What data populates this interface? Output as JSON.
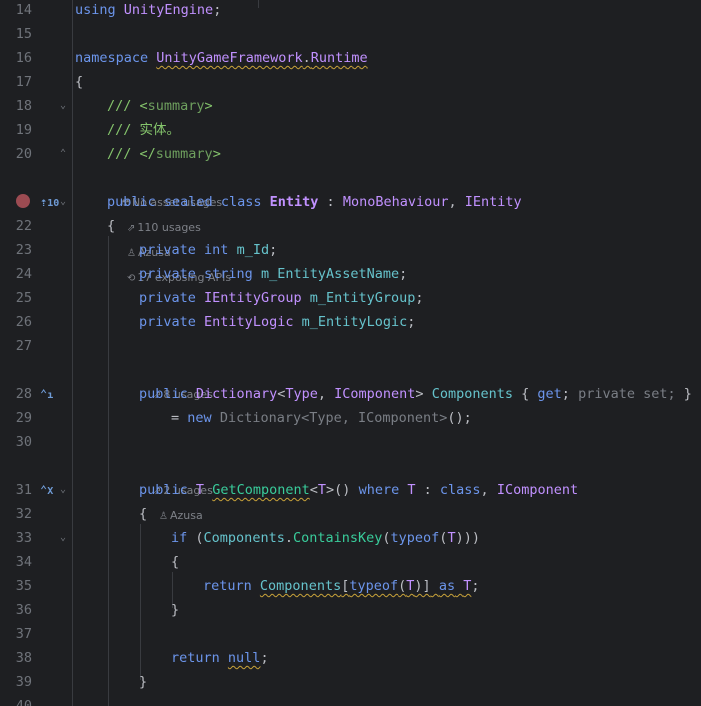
{
  "lines": {
    "l14": {
      "num": "14",
      "t1": "using",
      "t2": " UnityEngine",
      "t3": ";"
    },
    "l15": {
      "num": "15"
    },
    "l16": {
      "num": "16",
      "t1": "namespace",
      "t2": "UnityGameFramework",
      "t3": ".",
      "t4": "Runtime"
    },
    "l17": {
      "num": "17",
      "t1": "{"
    },
    "l18": {
      "num": "18",
      "t1": "/// <",
      "t2": "summary",
      "t3": ">"
    },
    "l19": {
      "num": "19",
      "t1": "/// 实体。"
    },
    "l20": {
      "num": "20",
      "t1": "/// </",
      "t2": "summary",
      "t3": ">"
    },
    "l21": {
      "t1": "public",
      "t2": "sealed",
      "t3": "class",
      "t4": "Entity",
      "t5": ":",
      "t6": "MonoBehaviour",
      "t7": ",",
      "t8": "IEntity"
    },
    "l22": {
      "num": "22",
      "t1": "{"
    },
    "l23": {
      "num": "23",
      "t1": "private",
      "t2": "int",
      "t3": "m_Id",
      "t4": ";"
    },
    "l24": {
      "num": "24",
      "t1": "private",
      "t2": "string",
      "t3": "m_EntityAssetName",
      "t4": ";"
    },
    "l25": {
      "num": "25",
      "t1": "private",
      "t2": "IEntityGroup",
      "t3": "m_EntityGroup",
      "t4": ";"
    },
    "l26": {
      "num": "26",
      "t1": "private",
      "t2": "EntityLogic",
      "t3": "m_EntityLogic",
      "t4": ";"
    },
    "l27": {
      "num": "27"
    },
    "l28": {
      "num": "28",
      "t1": "public",
      "t2": "Dictionary",
      "t3": "<",
      "t4": "Type",
      "t5": ",",
      "t6": "IComponent",
      "t7": ">",
      "t8": "Components",
      "t9": "{",
      "t10": "get",
      "t11": ";",
      "t12": "private set;",
      "t13": "}"
    },
    "l29": {
      "num": "29",
      "t1": "=",
      "t2": "new",
      "t3": "Dictionary<Type, IComponent>",
      "t4": "();"
    },
    "l30": {
      "num": "30"
    },
    "l31": {
      "num": "31",
      "t1": "public",
      "t2": "T",
      "t3": "GetComponent",
      "t4": "<",
      "t5": "T",
      "t6": ">()",
      "t7": "where",
      "t8": "T",
      "t9": ":",
      "t10": "class",
      "t11": ",",
      "t12": "IComponent"
    },
    "l32": {
      "num": "32",
      "t1": "{"
    },
    "l33": {
      "num": "33",
      "t1": "if",
      "t2": "(",
      "t3": "Components",
      "t4": ".",
      "t5": "ContainsKey",
      "t6": "(",
      "t7": "typeof",
      "t8": "(",
      "t9": "T",
      "t10": ")))"
    },
    "l34": {
      "num": "34",
      "t1": "{"
    },
    "l35": {
      "num": "35",
      "t1": "return",
      "t2": "Components",
      "t3": "[",
      "t4": "typeof",
      "t5": "(",
      "t6": "T",
      "t7": ")]",
      "t8": "as",
      "t9": "T",
      "t10": ";"
    },
    "l36": {
      "num": "36",
      "t1": "}"
    },
    "l37": {
      "num": "37"
    },
    "l38": {
      "num": "38",
      "t1": "return",
      "t2": "null",
      "t3": ";"
    },
    "l39": {
      "num": "39",
      "t1": "}"
    },
    "l40": {
      "num": "40"
    }
  },
  "hints": {
    "h20": {
      "a": "No asset usages",
      "b": "110 usages",
      "c": "Azusa",
      "d": "17 exposing APIs"
    },
    "h27": {
      "a": "8 usages"
    },
    "h30": {
      "a": "2 usages",
      "b": "Azusa"
    }
  },
  "gutter": {
    "impl_21": "10",
    "impl_31": "X"
  },
  "icons": {
    "breakpoint": "breakpoint-icon",
    "asset": "unity-asset-icon",
    "usages": "usages-icon",
    "author": "person-icon",
    "api": "exposing-api-icon",
    "fold": "fold-chevron-icon"
  }
}
